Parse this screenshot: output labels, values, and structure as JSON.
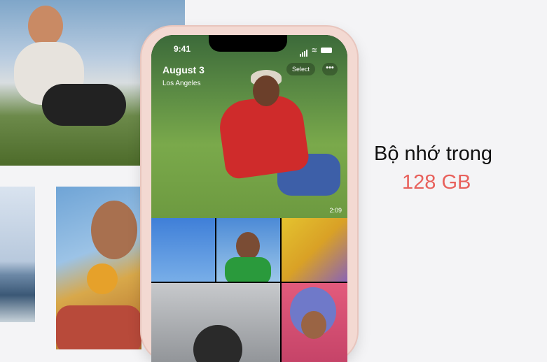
{
  "phone_screen": {
    "status_time": "9:41",
    "album_title": "August 3",
    "album_location": "Los Angeles",
    "select_label": "Select",
    "more_label": "•••",
    "video_duration": "2:09"
  },
  "feature": {
    "label": "Bộ nhớ trong",
    "value": "128 GB",
    "value_color": "#e8615c"
  },
  "icons": [
    "signal-icon",
    "wifi-icon",
    "battery-icon"
  ]
}
